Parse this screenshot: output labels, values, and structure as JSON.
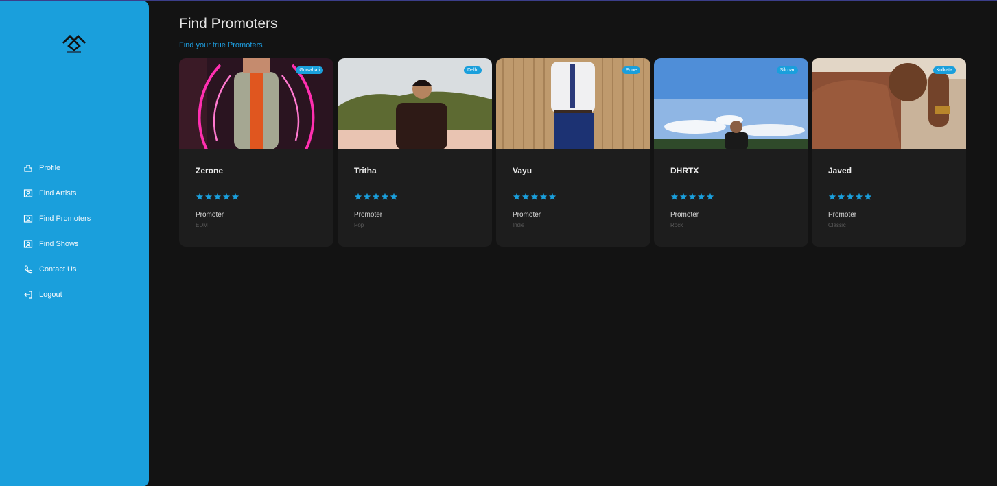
{
  "sidebar": {
    "logo_icon": "brand-logo",
    "items": [
      {
        "label": "Profile",
        "icon": "profile-icon"
      },
      {
        "label": "Find Artists",
        "icon": "id-card-icon"
      },
      {
        "label": "Find Promoters",
        "icon": "id-card-icon"
      },
      {
        "label": "Find Shows",
        "icon": "id-card-icon"
      },
      {
        "label": "Contact Us",
        "icon": "phone-icon"
      },
      {
        "label": "Logout",
        "icon": "logout-icon"
      }
    ]
  },
  "header": {
    "title": "Find Promoters",
    "subtitle": "Find your true Promoters"
  },
  "promoters": [
    {
      "name": "Zerone",
      "city": "Guwahati",
      "role": "Promoter",
      "genre": "EDM",
      "rating": 5
    },
    {
      "name": "Tritha",
      "city": "Delhi",
      "role": "Promoter",
      "genre": "Pop",
      "rating": 5
    },
    {
      "name": "Vayu",
      "city": "Pune",
      "role": "Promoter",
      "genre": "Indie",
      "rating": 5
    },
    {
      "name": "DHRTX",
      "city": "Silchar",
      "role": "Promoter",
      "genre": "Rock",
      "rating": 5
    },
    {
      "name": "Javed",
      "city": "Kolkata",
      "role": "Promoter",
      "genre": "Classic",
      "rating": 5
    }
  ],
  "colors": {
    "accent": "#1a9fdc",
    "background": "#131313",
    "card": "#1d1d1d",
    "star": "#1a9fdc"
  }
}
